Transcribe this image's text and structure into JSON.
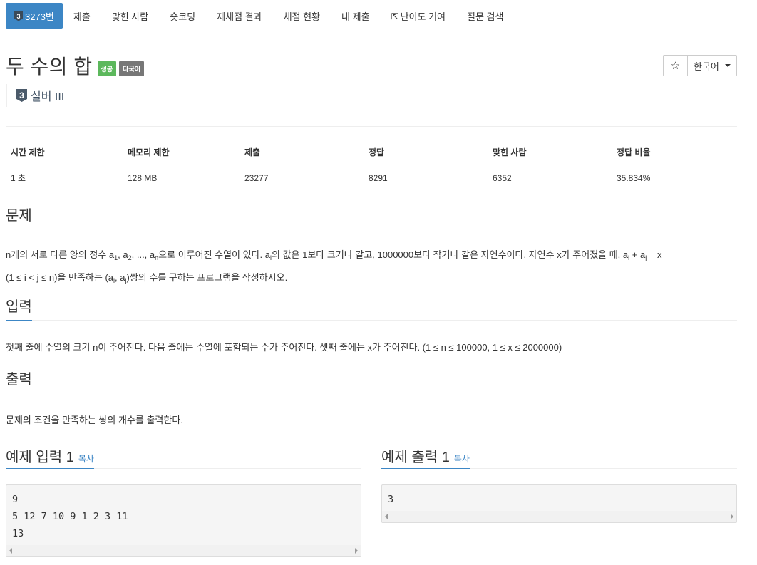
{
  "nav": {
    "problem_tab": "3273번",
    "problem_tier": "3",
    "items": [
      "제출",
      "맞힌 사람",
      "숏코딩",
      "재채점 결과",
      "채점 현황",
      "내 제출",
      "난이도 기여",
      "질문 검색"
    ]
  },
  "problem": {
    "title": "두 수의 합",
    "labels": [
      "성공",
      "다국어"
    ],
    "tier_num": "3",
    "tier": "실버 III"
  },
  "controls": {
    "star": "☆",
    "language": "한국어"
  },
  "info": {
    "headers": [
      "시간 제한",
      "메모리 제한",
      "제출",
      "정답",
      "맞힌 사람",
      "정답 비율"
    ],
    "values": [
      "1 초",
      "128 MB",
      "23277",
      "8291",
      "6352",
      "35.834%"
    ]
  },
  "sections": {
    "problem_title": "문제",
    "input_title": "입력",
    "input_text": "첫째 줄에 수열의 크기 n이 주어진다. 다음 줄에는 수열에 포함되는 수가 주어진다. 셋째 줄에는 x가 주어진다. (1 ≤ n ≤ 100000, 1 ≤ x ≤ 2000000)",
    "output_title": "출력",
    "output_text": "문제의 조건을 만족하는 쌍의 개수를 출력한다."
  },
  "samples": {
    "input_title": "예제 입력 1",
    "output_title": "예제 출력 1",
    "copy": "복사",
    "input_lines": [
      "9",
      "5 12 7 10 9 1 2 3 11",
      "13"
    ],
    "output_lines": [
      "3"
    ]
  },
  "colors": {
    "accent": "#3c86c5",
    "success": "#5cb85c",
    "gray_label": "#777777"
  }
}
